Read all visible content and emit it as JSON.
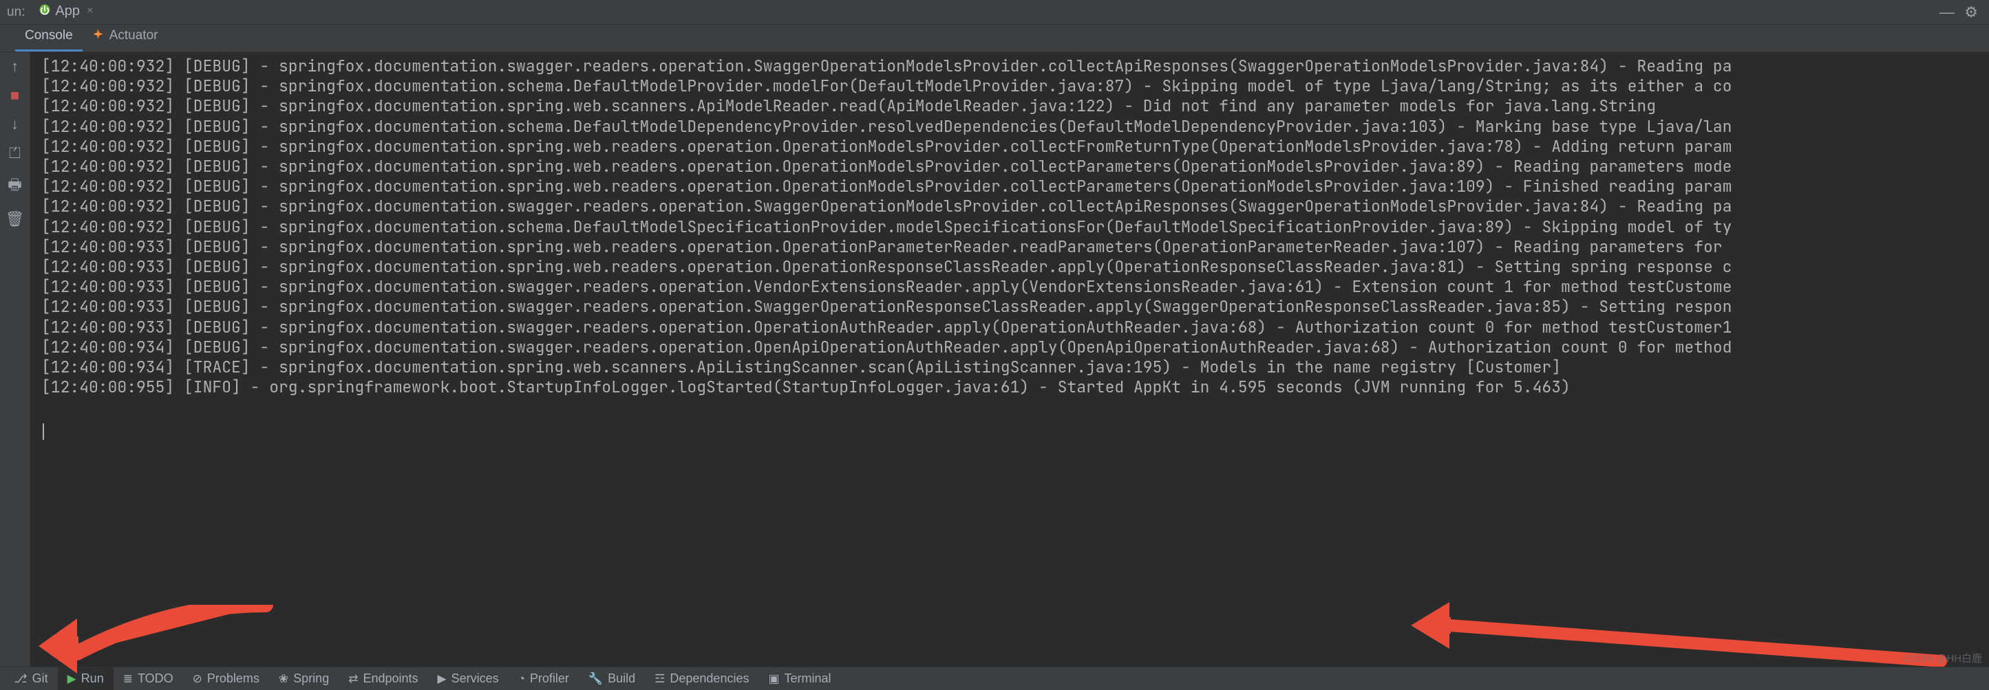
{
  "header": {
    "run_label": "un:",
    "config_name": "App",
    "close_glyph": "×",
    "gear_glyph": "⚙",
    "minus_glyph": "—"
  },
  "tabs": [
    {
      "label": "Console",
      "active": true,
      "icon": ""
    },
    {
      "label": "Actuator",
      "active": false,
      "icon": "actuator"
    }
  ],
  "gutter_icons": [
    {
      "name": "rerun-icon",
      "glyph": "↑"
    },
    {
      "name": "stop-icon",
      "glyph": "■",
      "cls": "stop"
    },
    {
      "name": "down-icon",
      "glyph": "↓"
    },
    {
      "name": "layout-icon",
      "glyph": "⏍"
    },
    {
      "name": "print-icon",
      "glyph": "🖶"
    },
    {
      "name": "trash-icon",
      "glyph": "🗑"
    }
  ],
  "log_lines": [
    "[12:40:00:932] [DEBUG] - springfox.documentation.swagger.readers.operation.SwaggerOperationModelsProvider.collectApiResponses(SwaggerOperationModelsProvider.java:84) - Reading pa",
    "[12:40:00:932] [DEBUG] - springfox.documentation.schema.DefaultModelProvider.modelFor(DefaultModelProvider.java:87) - Skipping model of type Ljava/lang/String; as its either a co",
    "[12:40:00:932] [DEBUG] - springfox.documentation.spring.web.scanners.ApiModelReader.read(ApiModelReader.java:122) - Did not find any parameter models for java.lang.String",
    "[12:40:00:932] [DEBUG] - springfox.documentation.schema.DefaultModelDependencyProvider.resolvedDependencies(DefaultModelDependencyProvider.java:103) - Marking base type Ljava/lan",
    "[12:40:00:932] [DEBUG] - springfox.documentation.spring.web.readers.operation.OperationModelsProvider.collectFromReturnType(OperationModelsProvider.java:78) - Adding return param",
    "[12:40:00:932] [DEBUG] - springfox.documentation.spring.web.readers.operation.OperationModelsProvider.collectParameters(OperationModelsProvider.java:89) - Reading parameters mode",
    "[12:40:00:932] [DEBUG] - springfox.documentation.spring.web.readers.operation.OperationModelsProvider.collectParameters(OperationModelsProvider.java:109) - Finished reading param",
    "[12:40:00:932] [DEBUG] - springfox.documentation.swagger.readers.operation.SwaggerOperationModelsProvider.collectApiResponses(SwaggerOperationModelsProvider.java:84) - Reading pa",
    "[12:40:00:932] [DEBUG] - springfox.documentation.schema.DefaultModelSpecificationProvider.modelSpecificationsFor(DefaultModelSpecificationProvider.java:89) - Skipping model of ty",
    "[12:40:00:933] [DEBUG] - springfox.documentation.spring.web.readers.operation.OperationParameterReader.readParameters(OperationParameterReader.java:107) - Reading parameters for ",
    "[12:40:00:933] [DEBUG] - springfox.documentation.spring.web.readers.operation.OperationResponseClassReader.apply(OperationResponseClassReader.java:81) - Setting spring response c",
    "[12:40:00:933] [DEBUG] - springfox.documentation.swagger.readers.operation.VendorExtensionsReader.apply(VendorExtensionsReader.java:61) - Extension count 1 for method testCustome",
    "[12:40:00:933] [DEBUG] - springfox.documentation.swagger.readers.operation.SwaggerOperationResponseClassReader.apply(SwaggerOperationResponseClassReader.java:85) - Setting respon",
    "[12:40:00:933] [DEBUG] - springfox.documentation.swagger.readers.operation.OperationAuthReader.apply(OperationAuthReader.java:68) - Authorization count 0 for method testCustomer1",
    "[12:40:00:934] [DEBUG] - springfox.documentation.swagger.readers.operation.OpenApiOperationAuthReader.apply(OpenApiOperationAuthReader.java:68) - Authorization count 0 for method",
    "[12:40:00:934] [TRACE] - springfox.documentation.spring.web.scanners.ApiListingScanner.scan(ApiListingScanner.java:195) - Models in the name registry [Customer]",
    "[12:40:00:955] [INFO] - org.springframework.boot.StartupInfoLogger.logStarted(StartupInfoLogger.java:61) - Started AppKt in 4.595 seconds (JVM running for 5.463)"
  ],
  "footer": [
    {
      "name": "git",
      "label": "Git",
      "icon": "⎇"
    },
    {
      "name": "run",
      "label": "Run",
      "icon": "▶",
      "icon_cls": "play",
      "active": true
    },
    {
      "name": "todo",
      "label": "TODO",
      "icon": "≣"
    },
    {
      "name": "problems",
      "label": "Problems",
      "icon": "⊘"
    },
    {
      "name": "spring",
      "label": "Spring",
      "icon": "❀"
    },
    {
      "name": "endpoints",
      "label": "Endpoints",
      "icon": "⇄"
    },
    {
      "name": "services",
      "label": "Services",
      "icon": "▶"
    },
    {
      "name": "profiler",
      "label": "Profiler",
      "icon": "◔"
    },
    {
      "name": "build",
      "label": "Build",
      "icon": "🔧"
    },
    {
      "name": "dependencies",
      "label": "Dependencies",
      "icon": "☲"
    },
    {
      "name": "terminal",
      "label": "Terminal",
      "icon": "▣"
    }
  ],
  "watermark": "CSDN @HH白鹿"
}
